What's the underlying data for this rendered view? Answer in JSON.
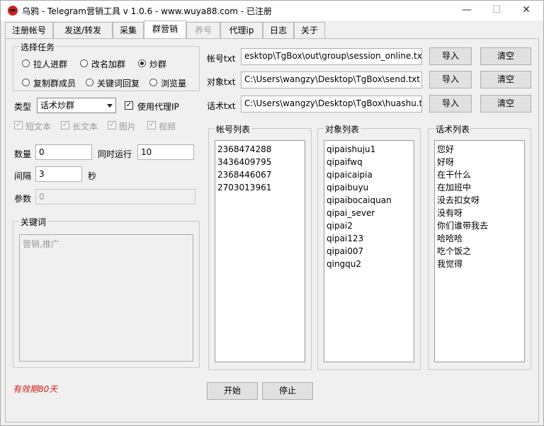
{
  "title": "乌鸦 - Telegram营销工具 v 1.0.6 - www.wuya88.com - 已注册",
  "window_buttons": {
    "minimize": "—",
    "maximize": "☐",
    "close": "✕"
  },
  "tabs": [
    {
      "label": "注册帐号"
    },
    {
      "label": "发送/转发"
    },
    {
      "label": "采集"
    },
    {
      "label": "群营销"
    },
    {
      "label": "养号"
    },
    {
      "label": "代理ip"
    },
    {
      "label": "日志"
    },
    {
      "label": "关于"
    }
  ],
  "task": {
    "legend": "选择任务",
    "options": [
      {
        "label": "拉人进群",
        "checked": false
      },
      {
        "label": "改名加群",
        "checked": false
      },
      {
        "label": "炒群",
        "checked": true
      },
      {
        "label": "复制群成员",
        "checked": false
      },
      {
        "label": "关键词回复",
        "checked": false
      },
      {
        "label": "浏览量",
        "checked": false
      }
    ]
  },
  "type_label": "类型",
  "type_value": "话术炒群",
  "use_proxy_label": "使用代理IP",
  "use_proxy_checked": true,
  "content_types": [
    {
      "label": "短文本",
      "checked": true
    },
    {
      "label": "长文本",
      "checked": true
    },
    {
      "label": "图片",
      "checked": true
    },
    {
      "label": "视频",
      "checked": true
    }
  ],
  "quantity_label": "数量",
  "quantity_value": "0",
  "concurrent_label": "同时运行",
  "concurrent_value": "10",
  "interval_label": "间隔",
  "interval_value": "3",
  "interval_unit": "秒",
  "param_label": "参数",
  "param_value": "0",
  "keywords_legend": "关键词",
  "keywords_placeholder": "营销,推广",
  "validity_text": "有效期80天",
  "files": {
    "account_label": "帐号txt",
    "account_path": "esktop\\TgBox\\out\\group\\session_online.txt",
    "target_label": "对象txt",
    "target_path": "C:\\Users\\wangzy\\Desktop\\TgBox\\send.txt",
    "script_label": "话术txt",
    "script_path": "C:\\Users\\wangzy\\Desktop\\TgBox\\huashu.tx",
    "import_label": "导入",
    "clear_label": "清空"
  },
  "lists": {
    "accounts_title": "帐号列表",
    "accounts": [
      "2368474288",
      "3436409795",
      "2368446067",
      "2703013961"
    ],
    "targets_title": "对象列表",
    "targets": [
      "qipaishuju1",
      "qipaifwq",
      "qipaicaipia",
      "qipaibuyu",
      "qipaibocaiquan",
      "qipai_sever",
      "qipai2",
      "qipai123",
      "qipai007",
      "qingqu2"
    ],
    "scripts_title": "话术列表",
    "scripts": [
      "您好",
      "好呀",
      "在干什么",
      "在加班中",
      "没去扣女呀",
      "没有呀",
      "你们谁带我去",
      "哈哈哈",
      "吃个饭之",
      "我觉得"
    ]
  },
  "start_label": "开始",
  "stop_label": "停止"
}
